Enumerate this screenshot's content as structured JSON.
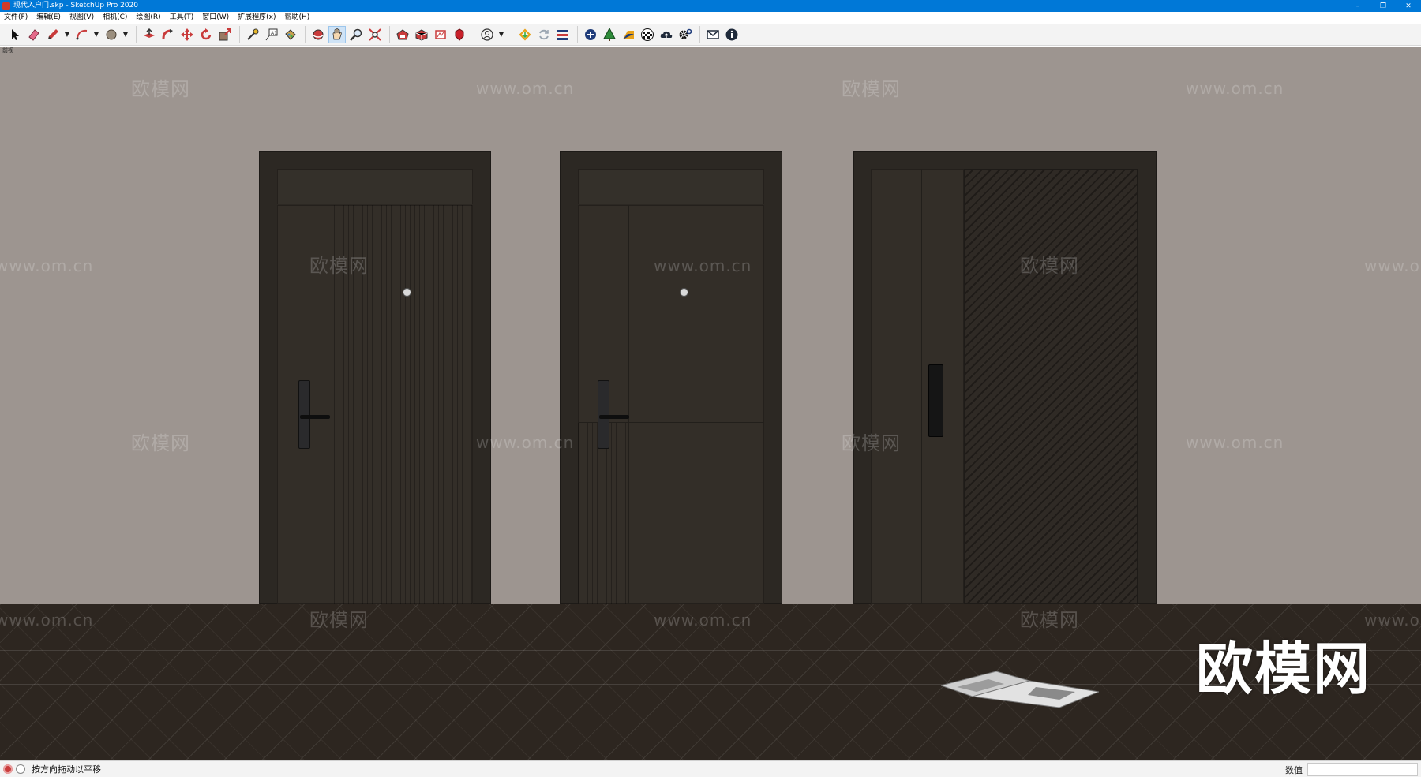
{
  "window": {
    "title": "现代入户门.skp - SketchUp Pro 2020",
    "controls": {
      "minimize": "–",
      "restore": "❐",
      "close": "✕"
    }
  },
  "menu": {
    "items": [
      "文件(F)",
      "编辑(E)",
      "视图(V)",
      "相机(C)",
      "绘图(R)",
      "工具(T)",
      "窗口(W)",
      "扩展程序(x)",
      "帮助(H)"
    ]
  },
  "toolbar": {
    "icons": [
      "select-icon",
      "eraser-icon",
      "pencil-icon",
      "arc-icon",
      "shape-icon",
      "push-pull-icon",
      "follow-me-icon",
      "move-icon",
      "rotate-icon",
      "scale-icon",
      "tape-measure-icon",
      "text-icon",
      "paint-bucket-icon",
      "orbit-icon",
      "pan-icon",
      "zoom-icon",
      "zoom-extents-icon",
      "warehouse-icon",
      "extension-warehouse-icon",
      "layout-icon",
      "ruby-icon",
      "account-icon",
      "trimble-icon",
      "sync-icon",
      "ruler-tool-icon",
      "add-icon",
      "tree-icon",
      "section-icon",
      "checker-icon",
      "cloud-icon",
      "settings-icon",
      "mail-icon",
      "info-icon"
    ],
    "active": "pan-icon"
  },
  "viewport": {
    "scene_tab": "前视",
    "wall_color": "#9d9590",
    "floor_color": "#2d2620",
    "door_color": "#332e28",
    "watermarks": {
      "cn": "欧模网",
      "url": "www.om.cn"
    },
    "brand_mark": "欧模网"
  },
  "status": {
    "hint": "按方向拖动以平移",
    "measurements_label": "数值",
    "measurements_value": ""
  }
}
